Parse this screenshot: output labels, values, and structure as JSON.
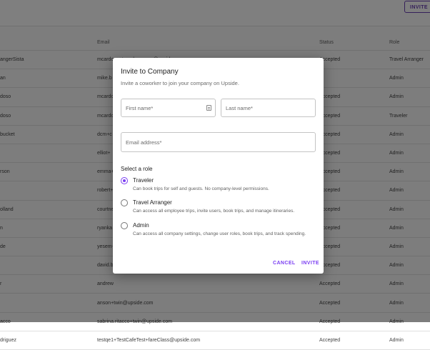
{
  "header": {
    "invite_label": "INVITE"
  },
  "table": {
    "columns": {
      "name": "",
      "email": "Email",
      "status": "Status",
      "role": "Role"
    },
    "rows": [
      {
        "name": "angerSista",
        "email": "mcardoso+travelarranger@upside.com",
        "status": "Accepted",
        "role": "Travel Arranger"
      },
      {
        "name": "an",
        "email": "mike.b",
        "status": "",
        "role": "Admin"
      },
      {
        "name": "doso",
        "email": "mcardo",
        "status": "Accepted",
        "role": "Admin"
      },
      {
        "name": "doso",
        "email": "mcardo",
        "status": "Accepted",
        "role": "Traveler"
      },
      {
        "name": "bucket",
        "email": "dcm+c",
        "status": "Accepted",
        "role": "Admin"
      },
      {
        "name": "",
        "email": "elliot+",
        "status": "Accepted",
        "role": "Admin"
      },
      {
        "name": "rson",
        "email": "emma+",
        "status": "Accepted",
        "role": "Admin"
      },
      {
        "name": "",
        "email": "robert+",
        "status": "Accepted",
        "role": "Admin"
      },
      {
        "name": "olland",
        "email": "courtne",
        "status": "Accepted",
        "role": "Admin"
      },
      {
        "name": "n",
        "email": "ryanka",
        "status": "Accepted",
        "role": "Admin"
      },
      {
        "name": "de",
        "email": "yesem+",
        "status": "Accepted",
        "role": "Admin"
      },
      {
        "name": "",
        "email": "david.b",
        "status": "Accepted",
        "role": "Admin"
      },
      {
        "name": "r",
        "email": "andrew",
        "status": "Accepted",
        "role": "Admin"
      },
      {
        "name": "",
        "email": "anson+twin@upside.com",
        "status": "Accepted",
        "role": "Admin"
      },
      {
        "name": "acco",
        "email": "sabrina.ritacco+twin@upside.com",
        "status": "Accepted",
        "role": "Admin"
      },
      {
        "name": "driguez",
        "email": "testqe1+TestCafeTest+fareClass@upside.com",
        "status": "Accepted",
        "role": "Admin"
      }
    ]
  },
  "dialog": {
    "title": "Invite to Company",
    "subtitle": "Invite a coworker to join your company on Upside.",
    "first_name_placeholder": "First name*",
    "last_name_placeholder": "Last name*",
    "email_placeholder": "Email address*",
    "role_section_label": "Select a role",
    "roles": [
      {
        "title": "Traveler",
        "description": "Can book trips for self and guests. No company-level permissions.",
        "selected": true
      },
      {
        "title": "Travel Arranger",
        "description": "Can access all employee trips, invite users, book trips, and manage itineraries.",
        "selected": false
      },
      {
        "title": "Admin",
        "description": "Can access all company settings, change user roles, book trips, and track spending.",
        "selected": false
      }
    ],
    "cancel_label": "CANCEL",
    "invite_label": "INVITE"
  },
  "colors": {
    "accent": "#7b3ff2",
    "overlay": "rgba(0,0,0,0.5)"
  }
}
